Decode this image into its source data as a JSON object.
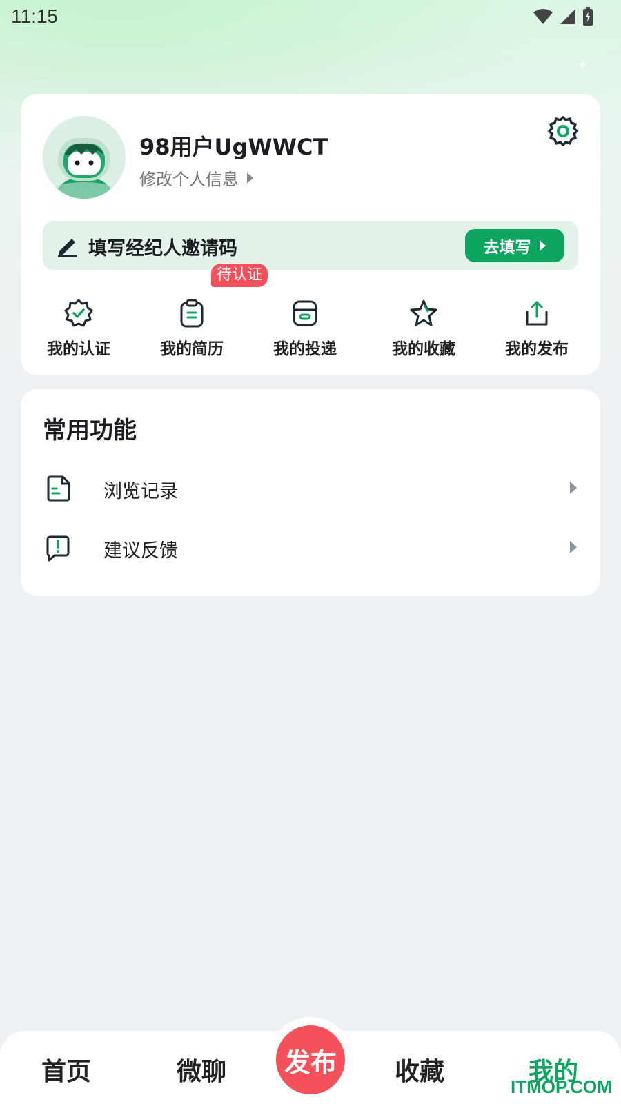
{
  "status_bar": {
    "time": "11:15"
  },
  "profile": {
    "username": "98用户UgWWCT",
    "edit_info": "修改个人信息"
  },
  "invite": {
    "label": "填写经纪人邀请码",
    "button": "去填写"
  },
  "quick_actions": [
    {
      "label": "我的认证",
      "icon": "verified-badge-icon"
    },
    {
      "label": "我的简历",
      "icon": "clipboard-icon",
      "badge": "待认证"
    },
    {
      "label": "我的投递",
      "icon": "inbox-box-icon"
    },
    {
      "label": "我的收藏",
      "icon": "star-icon"
    },
    {
      "label": "我的发布",
      "icon": "upload-share-icon"
    }
  ],
  "functions": {
    "title": "常用功能",
    "items": [
      {
        "label": "浏览记录",
        "icon": "document-icon"
      },
      {
        "label": "建议反馈",
        "icon": "feedback-icon"
      }
    ]
  },
  "bottom_nav": {
    "home": "首页",
    "chat": "微聊",
    "publish": "发布",
    "favorites": "收藏",
    "mine": "我的"
  },
  "watermark": "ITMOP.COM",
  "colors": {
    "accent": "#0ea561",
    "badge": "#f4515b",
    "background": "#eef1f4"
  }
}
